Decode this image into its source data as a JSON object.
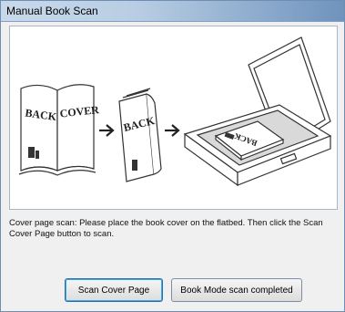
{
  "window": {
    "title": "Manual Book Scan"
  },
  "illustration": {
    "book_open_left_label": "BACK",
    "book_open_right_label": "COVER",
    "book_closed_label": "BACK",
    "book_on_scanner_label": "BACK"
  },
  "instruction_text": "Cover page scan: Please place the book cover on the flatbed. Then click the Scan Cover Page button to scan.",
  "buttons": {
    "scan_cover_label": "Scan Cover Page",
    "book_mode_done_label": "Book Mode scan completed"
  }
}
